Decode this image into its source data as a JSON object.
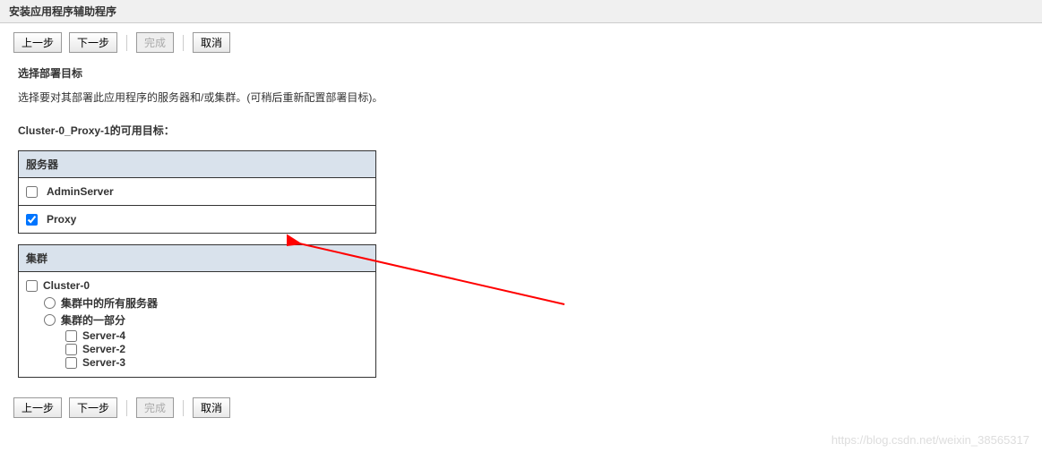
{
  "titleBar": "安装应用程序辅助程序",
  "buttons": {
    "back": "上一步",
    "next": "下一步",
    "finish": "完成",
    "cancel": "取消"
  },
  "heading": "选择部署目标",
  "description": "选择要对其部署此应用程序的服务器和/或集群。(可稍后重新配置部署目标)。",
  "targetsLabel": "Cluster-0_Proxy-1的可用目标：",
  "serversHeader": "服务器",
  "servers": [
    {
      "name": "AdminServer",
      "checked": false
    },
    {
      "name": "Proxy",
      "checked": true
    }
  ],
  "clustersHeader": "集群",
  "cluster": {
    "name": "Cluster-0",
    "options": {
      "allServers": "集群中的所有服务器",
      "partOfCluster": "集群的一部分"
    },
    "servers": [
      {
        "name": "Server-4"
      },
      {
        "name": "Server-2"
      },
      {
        "name": "Server-3"
      }
    ]
  },
  "watermark": "https://blog.csdn.net/weixin_38565317"
}
